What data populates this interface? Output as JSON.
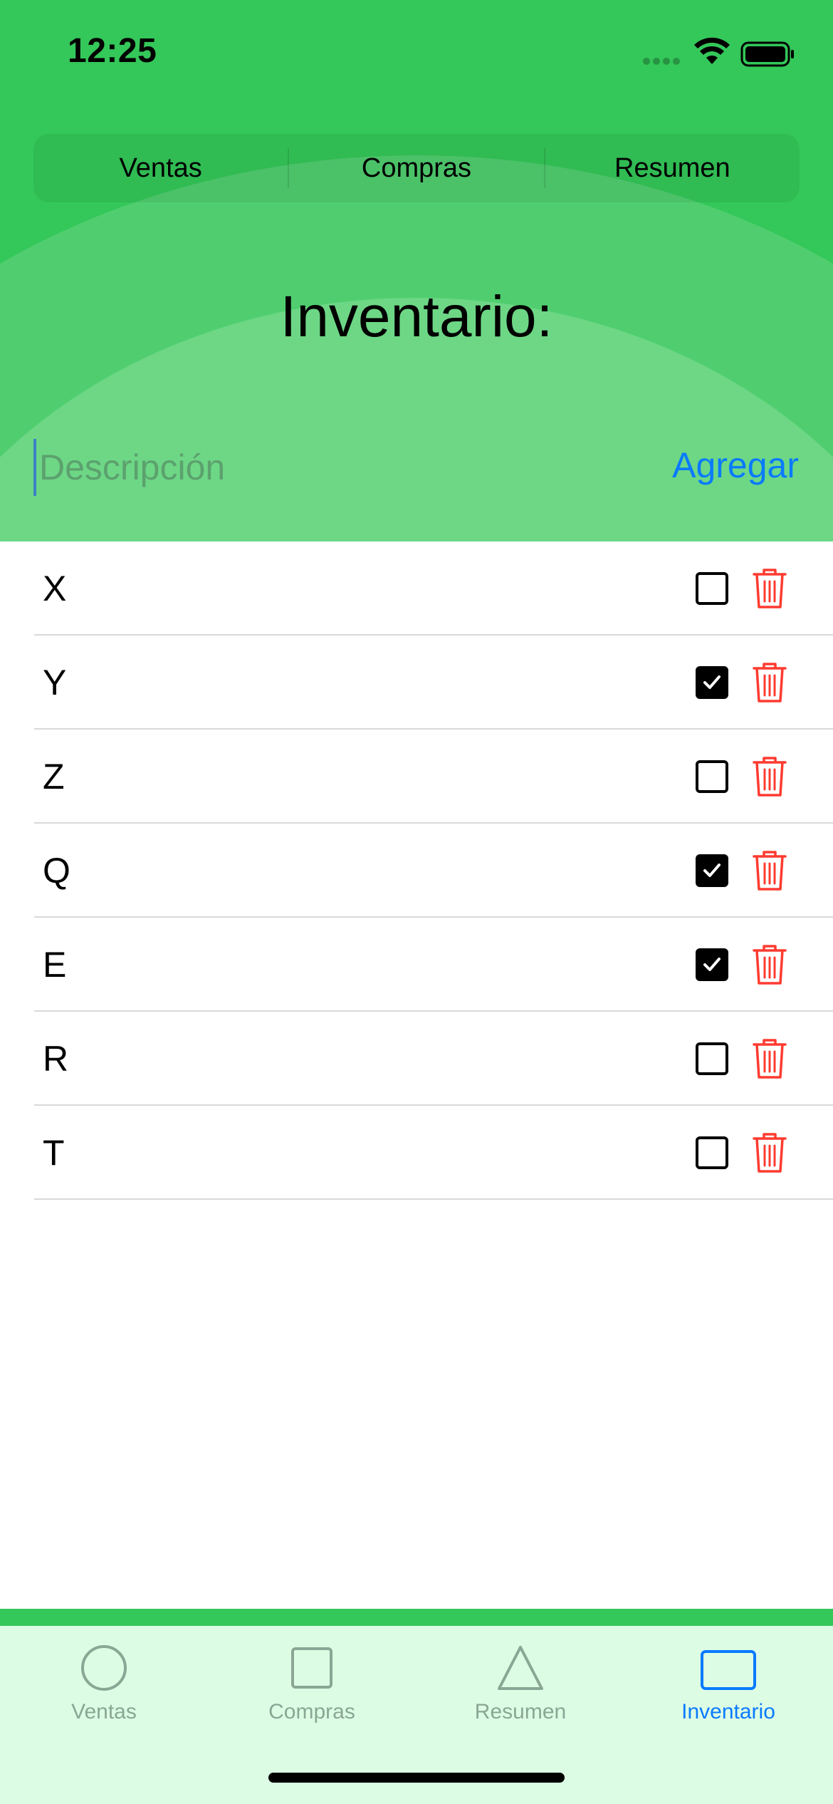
{
  "status_bar": {
    "time": "12:25"
  },
  "segmented": [
    "Ventas",
    "Compras",
    "Resumen"
  ],
  "title": "Inventario:",
  "input": {
    "placeholder": "Descripción",
    "value": ""
  },
  "add_button": "Agregar",
  "items": [
    {
      "label": "X",
      "checked": false
    },
    {
      "label": "Y",
      "checked": true
    },
    {
      "label": "Z",
      "checked": false
    },
    {
      "label": "Q",
      "checked": true
    },
    {
      "label": "E",
      "checked": true
    },
    {
      "label": "R",
      "checked": false
    },
    {
      "label": "T",
      "checked": false
    }
  ],
  "tabs": [
    {
      "label": "Ventas",
      "icon": "circle-icon",
      "active": false
    },
    {
      "label": "Compras",
      "icon": "square-icon",
      "active": false
    },
    {
      "label": "Resumen",
      "icon": "triangle-icon",
      "active": false
    },
    {
      "label": "Inventario",
      "icon": "rectangle-icon",
      "active": true
    }
  ],
  "colors": {
    "header_green": "#34c759",
    "tab_bar_bg": "#dcfde4",
    "accent_blue": "#0a7aff",
    "delete_red": "#ff3b30",
    "inactive_tab": "#8aa694"
  }
}
